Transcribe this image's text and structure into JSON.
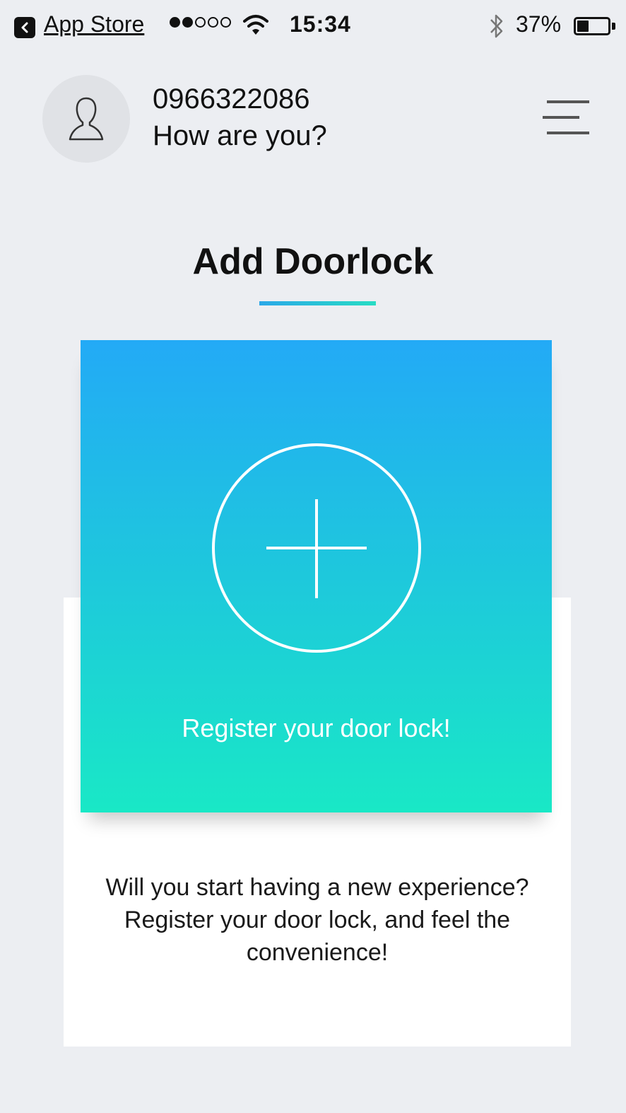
{
  "status_bar": {
    "back_app": "App Store",
    "time": "15:34",
    "battery_percent": "37%",
    "battery_level": 0.37,
    "signal_bars_filled": 2,
    "signal_bars_total": 5
  },
  "header": {
    "phone": "0966322086",
    "greeting": "How are you?",
    "avatar_icon": "user-icon",
    "menu_icon": "hamburger-menu-icon"
  },
  "main": {
    "title": "Add Doorlock",
    "card": {
      "icon": "plus-circle-icon",
      "label": "Register your door lock!",
      "gradient_top": "#23aaf6",
      "gradient_bottom": "#19e8c6"
    },
    "description": [
      "Will you start having a new experience?",
      "Register your door lock, and feel the",
      "convenience!"
    ]
  }
}
